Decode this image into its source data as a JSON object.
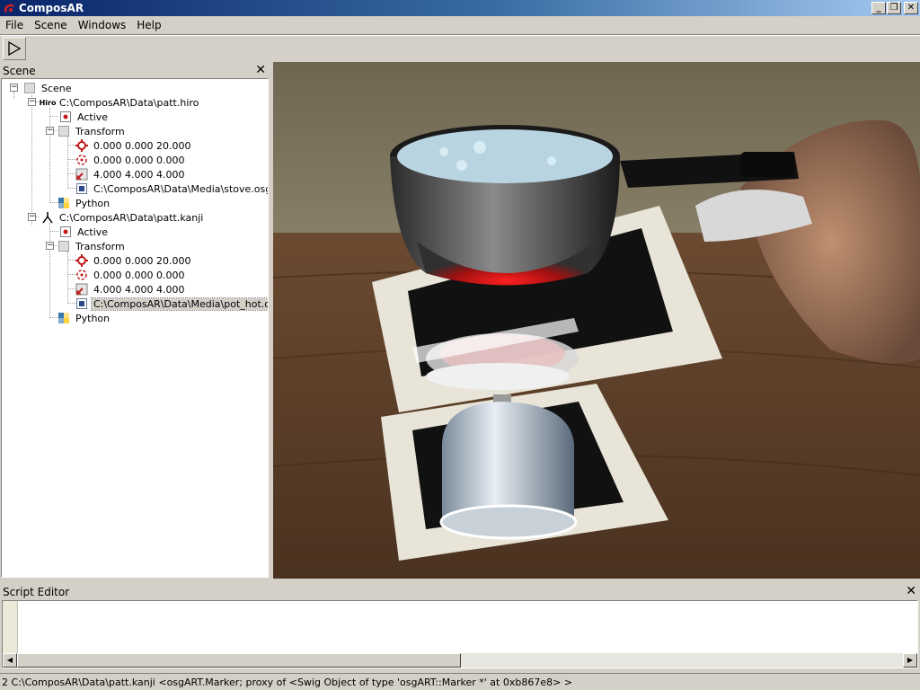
{
  "window": {
    "title": "ComposAR",
    "minimize": "_",
    "restore": "❐",
    "close": "✕"
  },
  "menu": [
    "File",
    "Scene",
    "Windows",
    "Help"
  ],
  "toolbar": {
    "play_icon": "play-icon"
  },
  "scene_panel": {
    "title": "Scene",
    "close": "✕",
    "tree": {
      "root": "Scene",
      "markers": [
        {
          "icon_label": "Hiro",
          "label": "C:\\ComposAR\\Data\\patt.hiro",
          "active": "Active",
          "transform": "Transform",
          "translate": "0.000 0.000 20.000",
          "rotate": "0.000 0.000 0.000",
          "scale": "4.000 4.000 4.000",
          "model": "C:\\ComposAR\\Data\\Media\\stove.osg",
          "python": "Python"
        },
        {
          "icon_label": "",
          "label": "C:\\ComposAR\\Data\\patt.kanji",
          "active": "Active",
          "transform": "Transform",
          "translate": "0.000 0.000 20.000",
          "rotate": "0.000 0.000 0.000",
          "scale": "4.000 4.000 4.000",
          "model": "C:\\ComposAR\\Data\\Media\\pot_hot.osg",
          "python": "Python"
        }
      ]
    }
  },
  "script_editor": {
    "title": "Script Editor",
    "close": "✕"
  },
  "status": "2 C:\\ComposAR\\Data\\patt.kanji <osgART.Marker; proxy of <Swig Object of type 'osgART::Marker *' at 0xb867e8> >"
}
